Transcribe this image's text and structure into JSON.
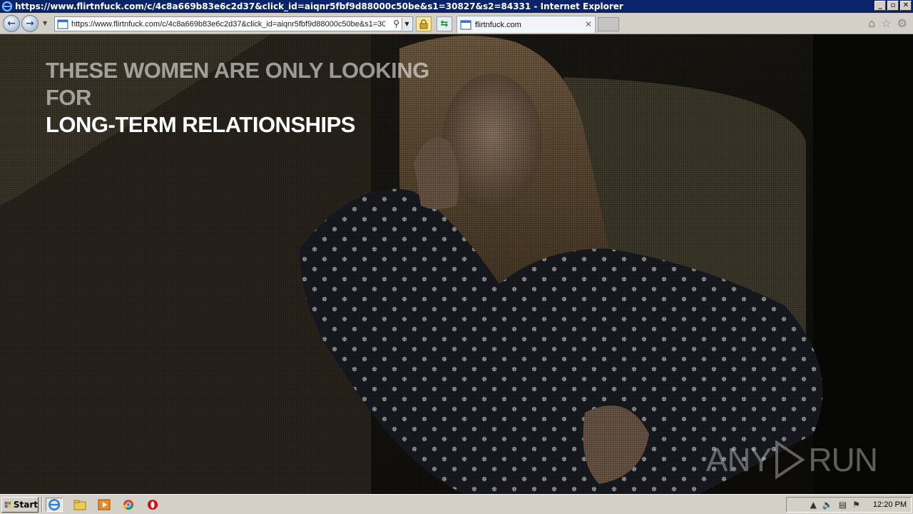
{
  "window": {
    "title": "https://www.flirtnfuck.com/c/4c8a669b83e6c2d37&click_id=aiqnr5fbf9d88000c50be&s1=30827&s2=84331 - Internet Explorer",
    "minimize": "_",
    "maximize": "▫",
    "close": "✕"
  },
  "navbar": {
    "back_icon": "back-arrow-icon",
    "forward_icon": "forward-arrow-icon",
    "address": "https://www.flirtnfuck.com/c/4c8a669b83e6c2d37&click_id=aiqnr5fbf9d88000c50be&s1=308",
    "tab_title": "flirtnfuck.com"
  },
  "content": {
    "headline_line1": "THESE WOMEN ARE ONLY LOOKING FOR",
    "headline_line2": "LONG-TERM RELATIONSHIPS",
    "watermark_left": "ANY",
    "watermark_right": "RUN"
  },
  "taskbar": {
    "start_label": "Start",
    "clock": "12:20 PM"
  },
  "colors": {
    "titlebar": "#0a246a",
    "chrome": "#d4d0c8",
    "lock": "#f5e7a0"
  }
}
